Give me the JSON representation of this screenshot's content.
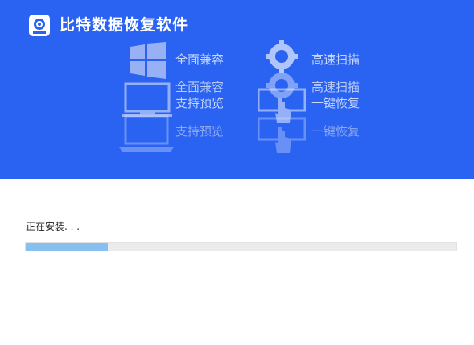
{
  "app": {
    "title": "比特数据恢复软件"
  },
  "features": {
    "row1_left": "全面兼容",
    "row1_right": "高速扫描",
    "row2_left": "全面兼容",
    "row2_right": "高速扫描",
    "row3_left": "支持预览",
    "row3_right": "一键恢复",
    "row4_left": "支持预览",
    "row4_right": "一键恢复"
  },
  "icons": [
    "windows-icon",
    "gear-icon",
    "monitor-icon",
    "laptop-icon",
    "hand-pointer-icon"
  ],
  "install": {
    "status": "正在安装. . .",
    "progress": 0.19
  },
  "colors": {
    "banner": "#2a62f2",
    "progress_fill": "#86bff0",
    "progress_track": "#ebebeb"
  }
}
